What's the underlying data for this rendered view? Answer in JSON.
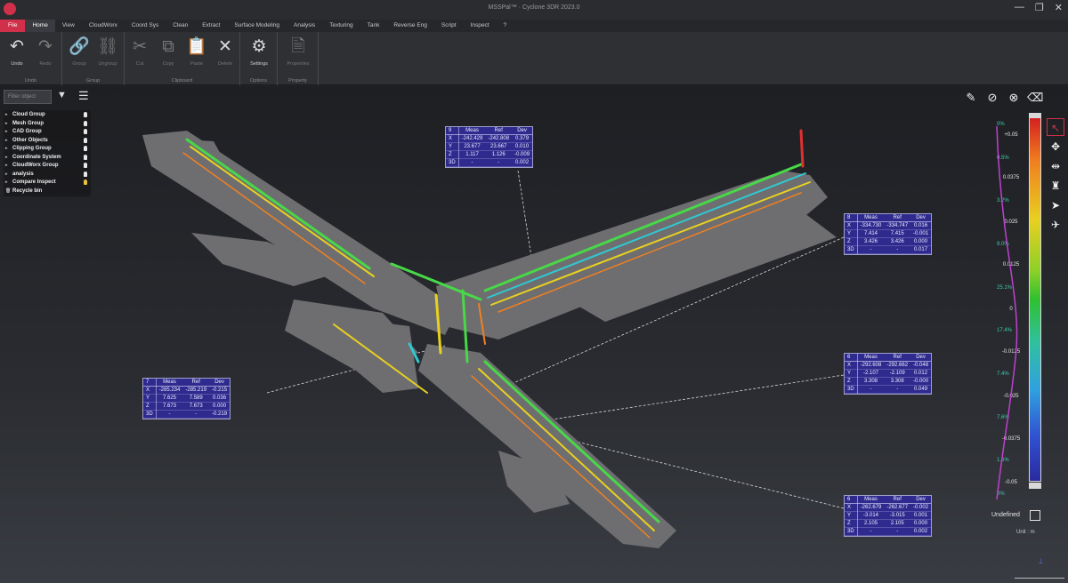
{
  "window": {
    "title": "MSSPal™ · Cyclone 3DR 2023.0",
    "controls": [
      "—",
      "❐",
      "✕"
    ]
  },
  "menu": {
    "tabs": [
      "File",
      "Home",
      "View",
      "CloudWorx",
      "Coord Sys",
      "Clean",
      "Extract",
      "Surface Modeling",
      "Analysis",
      "Texturing",
      "Tank",
      "Reverse Eng",
      "Script",
      "Inspect",
      "?"
    ]
  },
  "ribbon": {
    "groups": [
      {
        "label": "Undo",
        "buttons": [
          {
            "label": "Undo",
            "icon": "undo-icon"
          },
          {
            "label": "Redo",
            "icon": "redo-icon"
          }
        ]
      },
      {
        "label": "Group",
        "buttons": [
          {
            "label": "Group",
            "icon": "link-icon"
          },
          {
            "label": "Ungroup",
            "icon": "unlink-icon"
          }
        ]
      },
      {
        "label": "Clipboard",
        "buttons": [
          {
            "label": "Cut",
            "icon": "scissors-icon"
          },
          {
            "label": "Copy",
            "icon": "copy-icon"
          },
          {
            "label": "Paste",
            "icon": "paste-icon"
          },
          {
            "label": "Delete",
            "icon": "delete-icon"
          }
        ]
      },
      {
        "label": "Options",
        "buttons": [
          {
            "label": "Settings",
            "icon": "gears-icon"
          }
        ]
      },
      {
        "label": "Property",
        "buttons": [
          {
            "label": "Properties",
            "icon": "document-icon"
          }
        ]
      }
    ]
  },
  "tree": {
    "filter_placeholder": "Filter object",
    "items": [
      {
        "label": "Cloud Group",
        "icon": "bulb-icon"
      },
      {
        "label": "Mesh Group",
        "icon": "bulb-icon"
      },
      {
        "label": "CAD Group",
        "icon": "bulb-icon"
      },
      {
        "label": "Other Objects",
        "icon": "bulb-icon"
      },
      {
        "label": "Clipping Group",
        "icon": "bulb-icon"
      },
      {
        "label": "Coordinate System",
        "icon": "bulb-icon"
      },
      {
        "label": "CloudWorx Group",
        "icon": "bulb-icon"
      },
      {
        "label": "analysis",
        "icon": "bulb-icon"
      },
      {
        "label": "Compare Inspect",
        "icon": "bulb-on-icon"
      },
      {
        "label": "Recycle bin",
        "icon": "trash-icon"
      }
    ]
  },
  "measurements": [
    {
      "name": "9",
      "headers": [
        "Meas",
        "Ref",
        "Dev"
      ],
      "rows": [
        [
          "X",
          "-242.429",
          "-242.808",
          "0.379"
        ],
        [
          "Y",
          "23.677",
          "23.667",
          "0.010"
        ],
        [
          "Z",
          "1.117",
          "1.126",
          "-0.009"
        ],
        [
          "3D",
          "-",
          "-",
          "0.002"
        ]
      ]
    },
    {
      "name": "8",
      "headers": [
        "Meas",
        "Ref",
        "Dev"
      ],
      "rows": [
        [
          "X",
          "-334.730",
          "-334.747",
          "0.016"
        ],
        [
          "Y",
          "7.414",
          "7.415",
          "-0.001"
        ],
        [
          "Z",
          "3.426",
          "3.426",
          "0.000"
        ],
        [
          "3D",
          "-",
          "-",
          "0.017"
        ]
      ]
    },
    {
      "name": "7",
      "headers": [
        "Meas",
        "Ref",
        "Dev"
      ],
      "rows": [
        [
          "X",
          "-285.234",
          "-285.219",
          "-0.215"
        ],
        [
          "Y",
          "7.625",
          "7.589",
          "0.036"
        ],
        [
          "Z",
          "7.673",
          "7.673",
          "0.000"
        ],
        [
          "3D",
          "-",
          "-",
          "-0.219"
        ]
      ]
    },
    {
      "name": "6",
      "headers": [
        "Meas",
        "Ref",
        "Dev"
      ],
      "rows": [
        [
          "X",
          "-292.608",
          "-292.662",
          "-0.048"
        ],
        [
          "Y",
          "-2.107",
          "-2.109",
          "0.012"
        ],
        [
          "Z",
          "3.308",
          "3.308",
          "-0.000"
        ],
        [
          "3D",
          "-",
          "-",
          "0.049"
        ]
      ]
    },
    {
      "name": "6",
      "headers": [
        "Meas",
        "Ref",
        "Dev"
      ],
      "rows": [
        [
          "X",
          "-262.679",
          "-262.677",
          "-0.002"
        ],
        [
          "Y",
          "-3.014",
          "-3.015",
          "0.001"
        ],
        [
          "Z",
          "2.105",
          "2.105",
          "0.000"
        ],
        [
          "3D",
          "-",
          "-",
          "0.002"
        ]
      ]
    }
  ],
  "color_scale": {
    "top_pct": "0%",
    "bottom_pct": "0%",
    "values": [
      "+0.05",
      "0.0375",
      "0.025",
      "0.0125",
      "0",
      "-0.0125",
      "-0.025",
      "-0.0375",
      "-0.05"
    ],
    "percentages": [
      "0.5%",
      "3.2%",
      "9.0%",
      "25.1%",
      "17.4%",
      "7.4%",
      "7.6%",
      "1.6%"
    ],
    "undefined_label": "Undefined",
    "unit_label": "Unit : m",
    "colors": {
      "max": "#d42020",
      "mid": "#30c030",
      "min": "#2a2aa0"
    }
  },
  "scene_colors": {
    "surface": "#6e6e70",
    "pipe_green": "#48d848",
    "pipe_yellow": "#e8d020",
    "pipe_orange": "#f08020",
    "pipe_red": "#e03030",
    "pipe_cyan": "#30c8d0"
  }
}
